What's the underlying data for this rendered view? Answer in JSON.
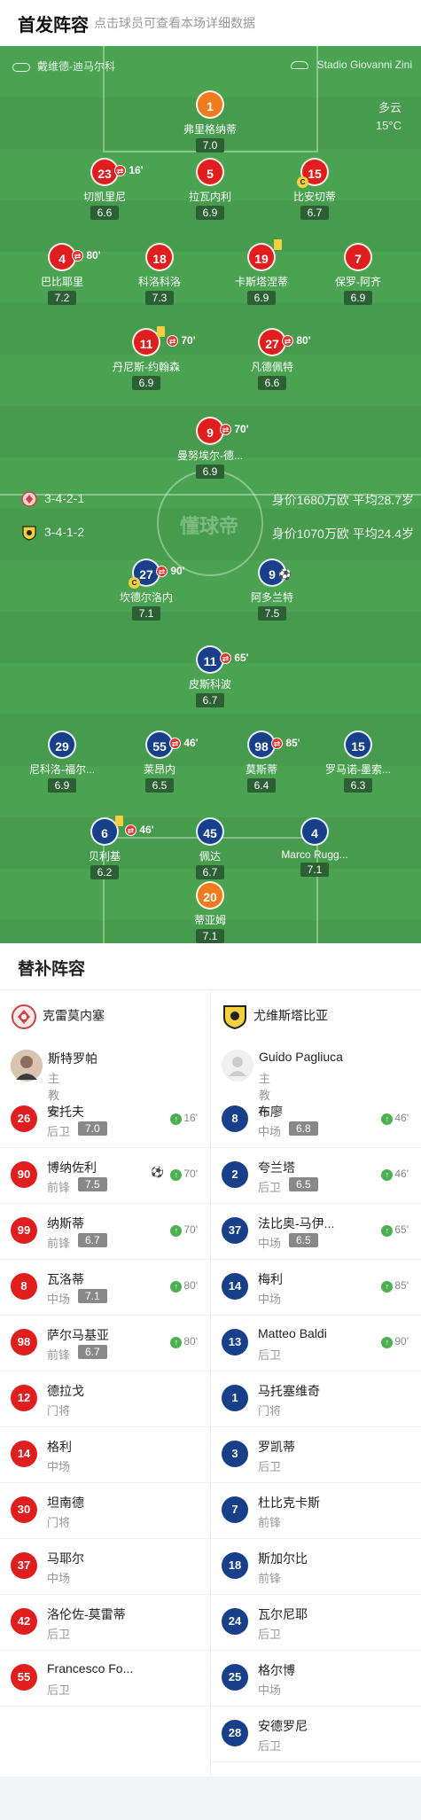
{
  "header": {
    "title": "首发阵容",
    "subtitle": "点击球员可查看本场详细数据"
  },
  "pitch": {
    "home_team": "戴维德-迪马尔科",
    "stadium": "Stadio Giovanni Zini",
    "weather": "多云",
    "temperature": "15°C",
    "watermark": "懂球帝",
    "home_formation": "3-4-2-1",
    "home_value": "身价1680万欧 平均28.7岁",
    "away_formation": "3-4-1-2",
    "away_value": "身价1070万欧 平均24.4岁",
    "home_players": [
      {
        "num": "1",
        "name": "弗里格纳蒂",
        "rating": "7.0",
        "gk": true
      },
      {
        "num": "23",
        "name": "切凯里尼",
        "rating": "6.6",
        "sub": "16'"
      },
      {
        "num": "5",
        "name": "拉瓦内利",
        "rating": "6.9"
      },
      {
        "num": "15",
        "name": "比安切蒂",
        "rating": "6.7",
        "captain": "C"
      },
      {
        "num": "4",
        "name": "巴比耶里",
        "rating": "7.2",
        "sub": "80'"
      },
      {
        "num": "18",
        "name": "科洛科洛",
        "rating": "7.3"
      },
      {
        "num": "19",
        "name": "卡斯塔涅蒂",
        "rating": "6.9",
        "yellow": true
      },
      {
        "num": "7",
        "name": "保罗-阿齐",
        "rating": "6.9"
      },
      {
        "num": "11",
        "name": "丹尼斯-约翰森",
        "rating": "6.9",
        "sub": "70'",
        "yellow": true
      },
      {
        "num": "27",
        "name": "凡德佩特",
        "rating": "6.6",
        "sub": "80'"
      },
      {
        "num": "9",
        "name": "曼努埃尔-德...",
        "rating": "6.9",
        "sub": "70'"
      }
    ],
    "away_players": [
      {
        "num": "27",
        "name": "坎德尔洛内",
        "rating": "7.1",
        "sub": "90'",
        "captain": "C"
      },
      {
        "num": "9",
        "name": "阿多兰特",
        "rating": "7.5",
        "goal": true
      },
      {
        "num": "11",
        "name": "皮斯科波",
        "rating": "6.7",
        "sub": "65'"
      },
      {
        "num": "29",
        "name": "尼科洛-福尔...",
        "rating": "6.9"
      },
      {
        "num": "55",
        "name": "莱昂内",
        "rating": "6.5",
        "sub": "46'"
      },
      {
        "num": "98",
        "name": "莫斯蒂",
        "rating": "6.4",
        "sub": "85'"
      },
      {
        "num": "15",
        "name": "罗马诺-墨索...",
        "rating": "6.3"
      },
      {
        "num": "6",
        "name": "贝利基",
        "rating": "6.2",
        "sub": "46'",
        "yellow": true
      },
      {
        "num": "45",
        "name": "佩达",
        "rating": "6.7"
      },
      {
        "num": "4",
        "name": "Marco Rugg...",
        "rating": "7.1"
      },
      {
        "num": "20",
        "name": "蒂亚姆",
        "rating": "7.1",
        "gk": true
      }
    ]
  },
  "subs": {
    "title": "替补阵容",
    "home": {
      "team": "克雷莫内塞",
      "coach": "斯特罗帕",
      "coach_role": "主教练",
      "players": [
        {
          "num": "26",
          "name": "安托夫",
          "pos": "后卫",
          "rating": "7.0",
          "time": "16'"
        },
        {
          "num": "90",
          "name": "博纳佐利",
          "pos": "前锋",
          "rating": "7.5",
          "time": "70'",
          "goal": true
        },
        {
          "num": "99",
          "name": "纳斯蒂",
          "pos": "前锋",
          "rating": "6.7",
          "time": "70'"
        },
        {
          "num": "8",
          "name": "瓦洛蒂",
          "pos": "中场",
          "rating": "7.1",
          "time": "80'"
        },
        {
          "num": "98",
          "name": "萨尔马基亚",
          "pos": "前锋",
          "rating": "6.7",
          "time": "80'"
        },
        {
          "num": "12",
          "name": "德拉戈",
          "pos": "门将"
        },
        {
          "num": "14",
          "name": "格利",
          "pos": "中场"
        },
        {
          "num": "30",
          "name": "坦南德",
          "pos": "门将"
        },
        {
          "num": "37",
          "name": "马耶尔",
          "pos": "中场"
        },
        {
          "num": "42",
          "name": "洛伦佐-莫雷蒂",
          "pos": "后卫"
        },
        {
          "num": "55",
          "name": "Francesco Fo...",
          "pos": "后卫"
        }
      ]
    },
    "away": {
      "team": "尤维斯塔比亚",
      "coach": "Guido Pagliuca",
      "coach_role": "主教练",
      "players": [
        {
          "num": "8",
          "name": "布廖",
          "pos": "中场",
          "rating": "6.8",
          "time": "46'"
        },
        {
          "num": "2",
          "name": "夸兰塔",
          "pos": "后卫",
          "rating": "6.5",
          "time": "46'"
        },
        {
          "num": "37",
          "name": "法比奥-马伊...",
          "pos": "中场",
          "rating": "6.5",
          "time": "65'"
        },
        {
          "num": "14",
          "name": "梅利",
          "pos": "中场",
          "time": "85'"
        },
        {
          "num": "13",
          "name": "Matteo Baldi",
          "pos": "后卫",
          "time": "90'"
        },
        {
          "num": "1",
          "name": "马托塞维奇",
          "pos": "门将"
        },
        {
          "num": "3",
          "name": "罗凯蒂",
          "pos": "后卫"
        },
        {
          "num": "7",
          "name": "杜比克卡斯",
          "pos": "前锋"
        },
        {
          "num": "18",
          "name": "斯加尔比",
          "pos": "前锋"
        },
        {
          "num": "24",
          "name": "瓦尔尼耶",
          "pos": "后卫"
        },
        {
          "num": "25",
          "name": "格尔博",
          "pos": "中场"
        },
        {
          "num": "28",
          "name": "安德罗尼",
          "pos": "后卫"
        }
      ]
    }
  },
  "colors": {
    "home": "#e01e1e",
    "away": "#173f8a",
    "goalkeeper": "#f07a1e",
    "pitch": "#4aa350"
  }
}
